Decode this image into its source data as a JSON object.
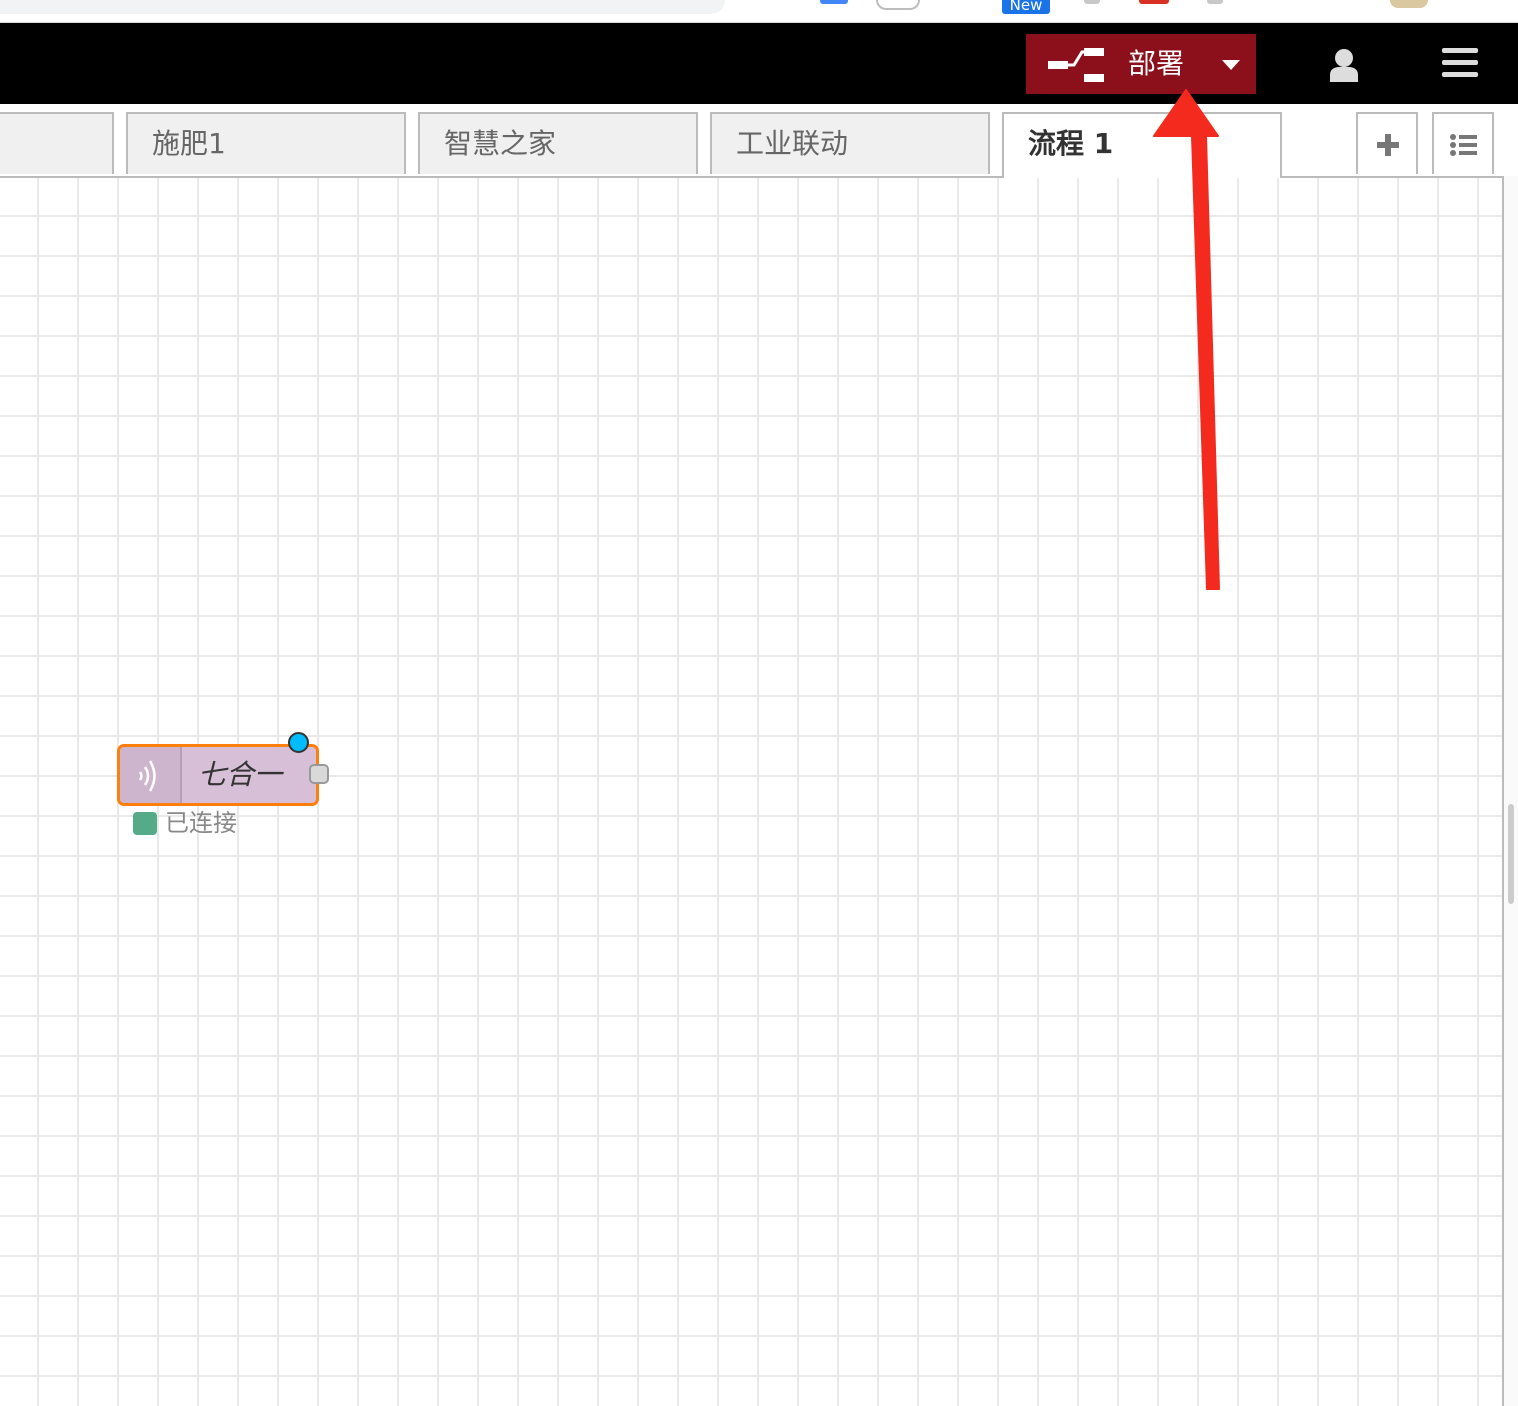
{
  "browser": {
    "new_badge": "New"
  },
  "header": {
    "deploy_label": "部署",
    "deploy_color": "#8c101c",
    "user_icon": "user-icon",
    "menu_icon": "hamburger-menu-icon"
  },
  "tabs": [
    {
      "label": ""
    },
    {
      "label": "施肥1"
    },
    {
      "label": "智慧之家"
    },
    {
      "label": "工业联动"
    },
    {
      "label": "流程 1",
      "active": true
    }
  ],
  "tab_tools": {
    "add_icon": "plus-icon",
    "list_icon": "list-icon"
  },
  "workspace": {
    "node": {
      "label": "七合一",
      "icon": "signal-waves-icon",
      "color": "#d8bfd8",
      "selected_outline_color": "#ff7f0e",
      "status_color": "#55aa88",
      "status_text": "已连接"
    }
  },
  "annotation": {
    "arrow_color": "#f42a1e"
  }
}
